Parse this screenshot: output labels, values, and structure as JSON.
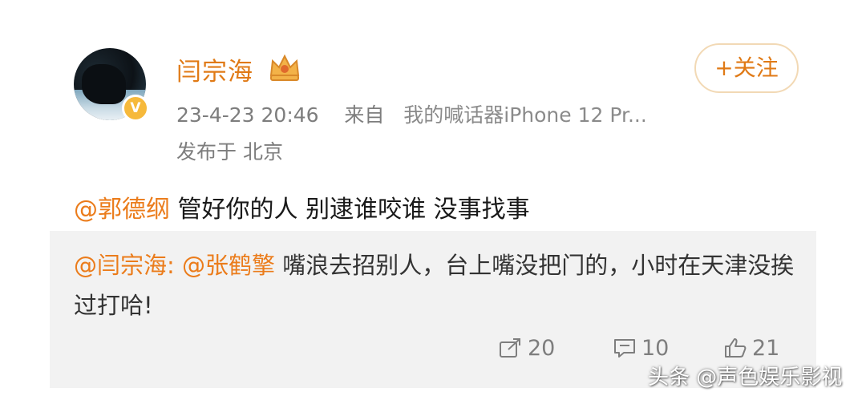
{
  "post": {
    "username": "闫宗海",
    "follow_label": "+关注",
    "timestamp": "23-4-23 20:46",
    "source_prefix": "来自",
    "source": "我的喊话器iPhone 12 Pr...",
    "location": "发布于 北京",
    "text_mention": "@郭德纲",
    "text_body": " 管好你的人 别逮谁咬谁 没事找事"
  },
  "repost": {
    "author": "@闫宗海:",
    "mention": "@张鹤擎",
    "text": " 嘴浪去招别人，台上嘴没把门的，小时在天津没挨过打哈!"
  },
  "actions": {
    "share_count": "20",
    "comment_count": "10",
    "like_count": "21"
  },
  "watermark": "头条 @声色娱乐影视",
  "colors": {
    "accent": "#e07a16",
    "mention": "#eb7c1b",
    "verified": "#f6b93b"
  },
  "icons": [
    "verified-badge-icon",
    "crown-icon",
    "share-icon",
    "comment-icon",
    "like-icon"
  ]
}
